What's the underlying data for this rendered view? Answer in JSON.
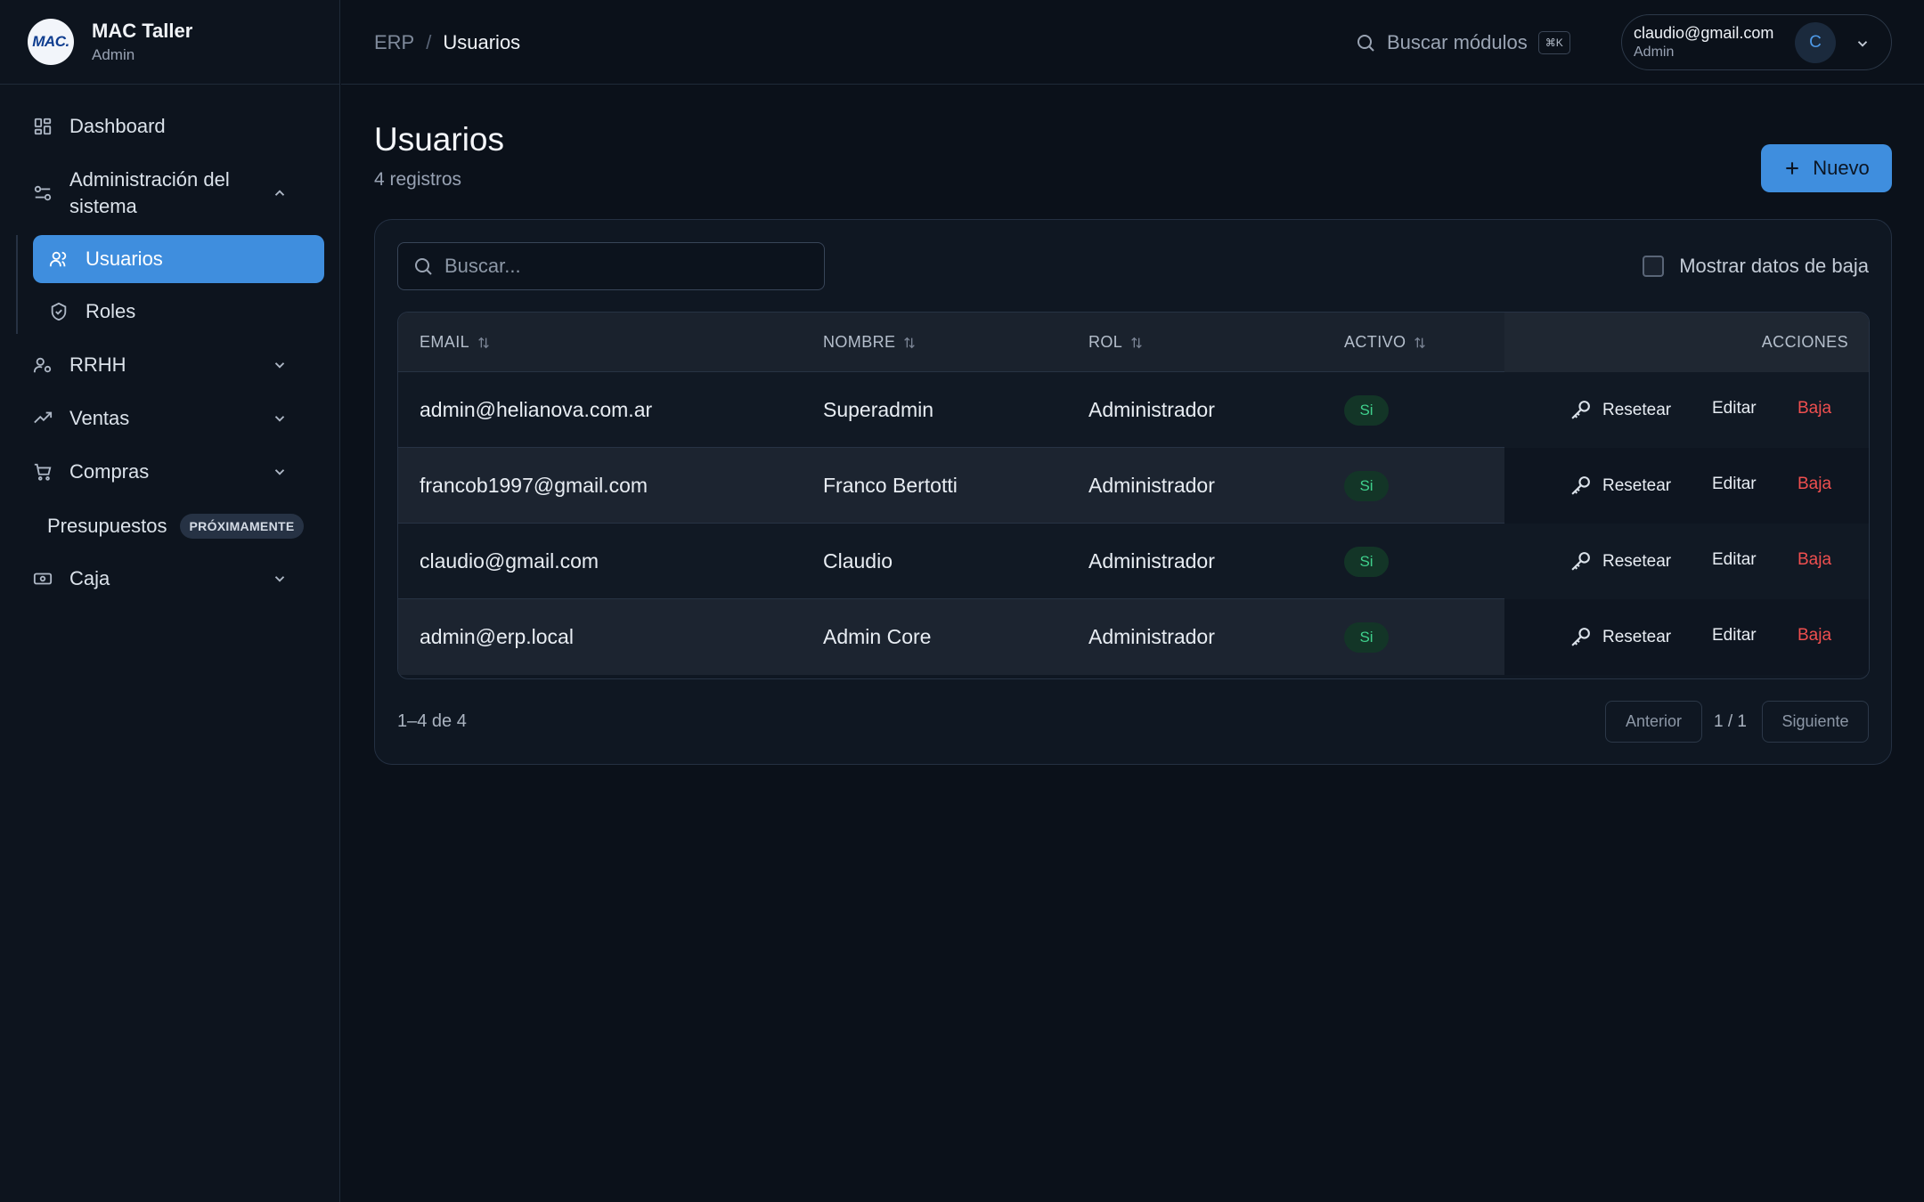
{
  "brand": {
    "logo_text": "MAC.",
    "name": "MAC Taller",
    "role": "Admin"
  },
  "sidebar": {
    "dashboard": "Dashboard",
    "admin_group": "Administración del sistema",
    "admin_children": [
      "Usuarios",
      "Roles"
    ],
    "rrhh": "RRHH",
    "ventas": "Ventas",
    "compras": "Compras",
    "presupuestos": "Presupuestos",
    "presupuestos_badge": "PRÓXIMAMENTE",
    "caja": "Caja"
  },
  "topbar": {
    "breadcrumb_root": "ERP",
    "breadcrumb_sep": "/",
    "breadcrumb_current": "Usuarios",
    "search_label": "Buscar módulos",
    "search_shortcut": "⌘K",
    "user_email": "claudio@gmail.com",
    "user_role": "Admin",
    "user_initial": "C"
  },
  "page": {
    "title": "Usuarios",
    "subtitle": "4 registros",
    "new_button": "Nuevo"
  },
  "filters": {
    "search_placeholder": "Buscar...",
    "search_value": "",
    "show_deleted_label": "Mostrar datos de baja"
  },
  "table": {
    "headers": [
      "EMAIL",
      "NOMBRE",
      "ROL",
      "ACTIVO",
      "ACCIONES"
    ],
    "rows": [
      {
        "email": "admin@helianova.com.ar",
        "nombre": "Superadmin",
        "rol": "Administrador",
        "activo": "Si"
      },
      {
        "email": "francob1997@gmail.com",
        "nombre": "Franco Bertotti",
        "rol": "Administrador",
        "activo": "Si"
      },
      {
        "email": "claudio@gmail.com",
        "nombre": "Claudio",
        "rol": "Administrador",
        "activo": "Si"
      },
      {
        "email": "admin@erp.local",
        "nombre": "Admin Core",
        "rol": "Administrador",
        "activo": "Si"
      }
    ],
    "actions": {
      "reset": "Resetear",
      "edit": "Editar",
      "delete": "Baja"
    }
  },
  "pagination": {
    "info": "1–4 de 4",
    "prev": "Anterior",
    "page": "1 / 1",
    "next": "Siguiente"
  },
  "colors": {
    "accent": "#3f8ede",
    "background": "#0b111a",
    "success_text": "#3fd08c",
    "danger": "#ef4f4f"
  },
  "icons": {
    "dashboard": "grid-icon",
    "admin": "sliders-icon",
    "usuarios": "users-icon",
    "roles": "shield-check-icon",
    "rrhh": "user-cog-icon",
    "ventas": "trending-up-icon",
    "compras": "cart-icon",
    "caja": "cash-icon",
    "reset": "key-icon"
  }
}
